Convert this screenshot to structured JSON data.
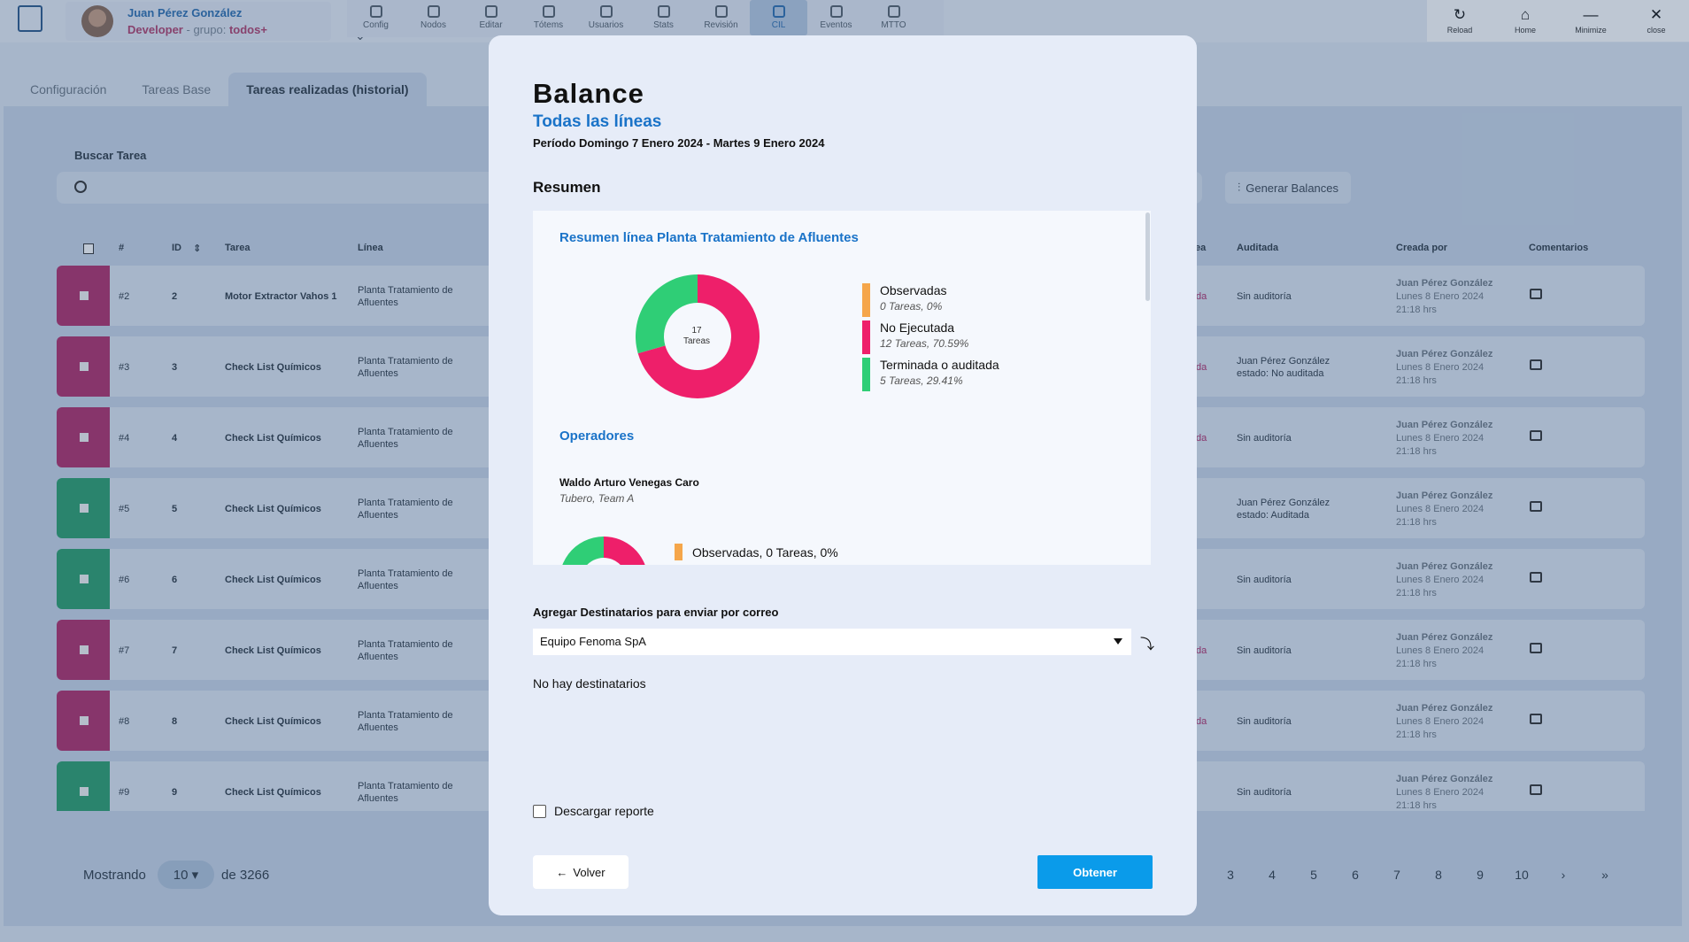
{
  "app": {
    "user_name": "Juan Pérez González",
    "user_role": "Developer",
    "group_label": "- grupo:",
    "group_name": "todos+",
    "lang": "ES",
    "nav": [
      {
        "label": "Config",
        "icon": "sliders-icon"
      },
      {
        "label": "Nodos",
        "icon": "hexagon-icon"
      },
      {
        "label": "Editar",
        "icon": "edit-icon"
      },
      {
        "label": "Tótems",
        "icon": "tablet-icon"
      },
      {
        "label": "Usuarios",
        "icon": "user-icon"
      },
      {
        "label": "Stats",
        "icon": "bar-chart-icon"
      },
      {
        "label": "Revisión",
        "icon": "check-square-icon"
      },
      {
        "label": "CIL",
        "icon": "clipboard-check-icon"
      },
      {
        "label": "Eventos",
        "icon": "calendar-icon"
      },
      {
        "label": "MTTO",
        "icon": "toolbox-icon"
      }
    ],
    "window": [
      {
        "label": "Reload",
        "glyph": "↻"
      },
      {
        "label": "Home",
        "glyph": "⌂"
      },
      {
        "label": "Minimize",
        "glyph": "—"
      },
      {
        "label": "close",
        "glyph": "✕"
      }
    ]
  },
  "page": {
    "tabs": [
      "Configuración",
      "Tareas Base",
      "Tareas realizadas (historial)"
    ],
    "search_label": "Buscar Tarea",
    "generate_button": "Generar Balances",
    "headers": {
      "num": "#",
      "id": "ID",
      "task": "Tarea",
      "line": "Línea",
      "audited_col": "ea",
      "audited": "Auditada",
      "created_by": "Creada por",
      "comments": "Comentarios"
    },
    "rows": [
      {
        "status": "red",
        "num": "#2",
        "id": "2",
        "task": "Motor Extractor Vahos 1",
        "line1": "Planta Tratamiento de",
        "line2": "Afluentes",
        "frag": "da",
        "audit1": "Sin auditoría",
        "audit2": "",
        "cb1": "Juan Pérez González",
        "cb2": "Lunes 8 Enero 2024",
        "cb3": "21:18 hrs"
      },
      {
        "status": "red",
        "num": "#3",
        "id": "3",
        "task": "Check List Químicos",
        "line1": "Planta Tratamiento de",
        "line2": "Afluentes",
        "frag": "da",
        "audit1": "Juan Pérez González",
        "audit2": "estado: No auditada",
        "cb1": "Juan Pérez González",
        "cb2": "Lunes 8 Enero 2024",
        "cb3": "21:18 hrs"
      },
      {
        "status": "red",
        "num": "#4",
        "id": "4",
        "task": "Check List Químicos",
        "line1": "Planta Tratamiento de",
        "line2": "Afluentes",
        "frag": "da",
        "audit1": "Sin auditoría",
        "audit2": "",
        "cb1": "Juan Pérez González",
        "cb2": "Lunes 8 Enero 2024",
        "cb3": "21:18 hrs"
      },
      {
        "status": "green",
        "num": "#5",
        "id": "5",
        "task": "Check List Químicos",
        "line1": "Planta Tratamiento de",
        "line2": "Afluentes",
        "frag": "",
        "audit1": "Juan Pérez González",
        "audit2": "estado: Auditada",
        "cb1": "Juan Pérez González",
        "cb2": "Lunes 8 Enero 2024",
        "cb3": "21:18 hrs"
      },
      {
        "status": "green",
        "num": "#6",
        "id": "6",
        "task": "Check List Químicos",
        "line1": "Planta Tratamiento de",
        "line2": "Afluentes",
        "frag": "",
        "audit1": "Sin auditoría",
        "audit2": "",
        "cb1": "Juan Pérez González",
        "cb2": "Lunes 8 Enero 2024",
        "cb3": "21:18 hrs"
      },
      {
        "status": "red",
        "num": "#7",
        "id": "7",
        "task": "Check List Químicos",
        "line1": "Planta Tratamiento de",
        "line2": "Afluentes",
        "frag": "da",
        "audit1": "Sin auditoría",
        "audit2": "",
        "cb1": "Juan Pérez González",
        "cb2": "Lunes 8 Enero 2024",
        "cb3": "21:18 hrs"
      },
      {
        "status": "red",
        "num": "#8",
        "id": "8",
        "task": "Check List Químicos",
        "line1": "Planta Tratamiento de",
        "line2": "Afluentes",
        "frag": "da",
        "audit1": "Sin auditoría",
        "audit2": "",
        "cb1": "Juan Pérez González",
        "cb2": "Lunes 8 Enero 2024",
        "cb3": "21:18 hrs"
      },
      {
        "status": "green",
        "num": "#9",
        "id": "9",
        "task": "Check List Químicos",
        "line1": "Planta Tratamiento de",
        "line2": "Afluentes",
        "frag": "",
        "audit1": "Sin auditoría",
        "audit2": "",
        "cb1": "Juan Pérez González",
        "cb2": "Lunes 8 Enero 2024",
        "cb3": "21:18 hrs"
      }
    ],
    "showing_label": "Mostrando",
    "per_page": "10",
    "total_label": "de 3266",
    "pages": [
      "3",
      "4",
      "5",
      "6",
      "7",
      "8",
      "9",
      "10",
      "›",
      "»"
    ]
  },
  "modal": {
    "title": "Balance",
    "subtitle": "Todas las líneas",
    "period": "Período Domingo 7 Enero 2024 - Martes 9 Enero 2024",
    "section": "Resumen",
    "summary_title": "Resumen línea Planta Tratamiento de Afluentes",
    "donut_total": "17",
    "donut_unit": "Tareas",
    "legend": [
      {
        "label": "Observadas",
        "detail": "0 Tareas, 0%",
        "color": "#f5a64a"
      },
      {
        "label": "No Ejecutada",
        "detail": "12 Tareas, 70.59%",
        "color": "#ee1f6a"
      },
      {
        "label": "Terminada o auditada",
        "detail": "5 Tareas, 29.41%",
        "color": "#2fce76"
      }
    ],
    "operators_title": "Operadores",
    "operator_name": "Waldo Arturo Venegas Caro",
    "operator_role": "Tubero, Team A",
    "operator_legend": "Observadas, 0 Tareas, 0%",
    "mail_label": "Agregar Destinatarios para enviar por correo",
    "mail_value": "Equipo Fenoma SpA",
    "no_recipients": "No hay destinatarios",
    "download_label": "Descargar reporte",
    "back_label": "Volver",
    "submit_label": "Obtener"
  },
  "chart_data": {
    "type": "pie",
    "categories": [
      "Observadas",
      "No Ejecutada",
      "Terminada o auditada"
    ],
    "values": [
      0,
      12,
      5
    ],
    "total": 17,
    "colors": [
      "#f5a64a",
      "#ee1f6a",
      "#2fce76"
    ]
  }
}
